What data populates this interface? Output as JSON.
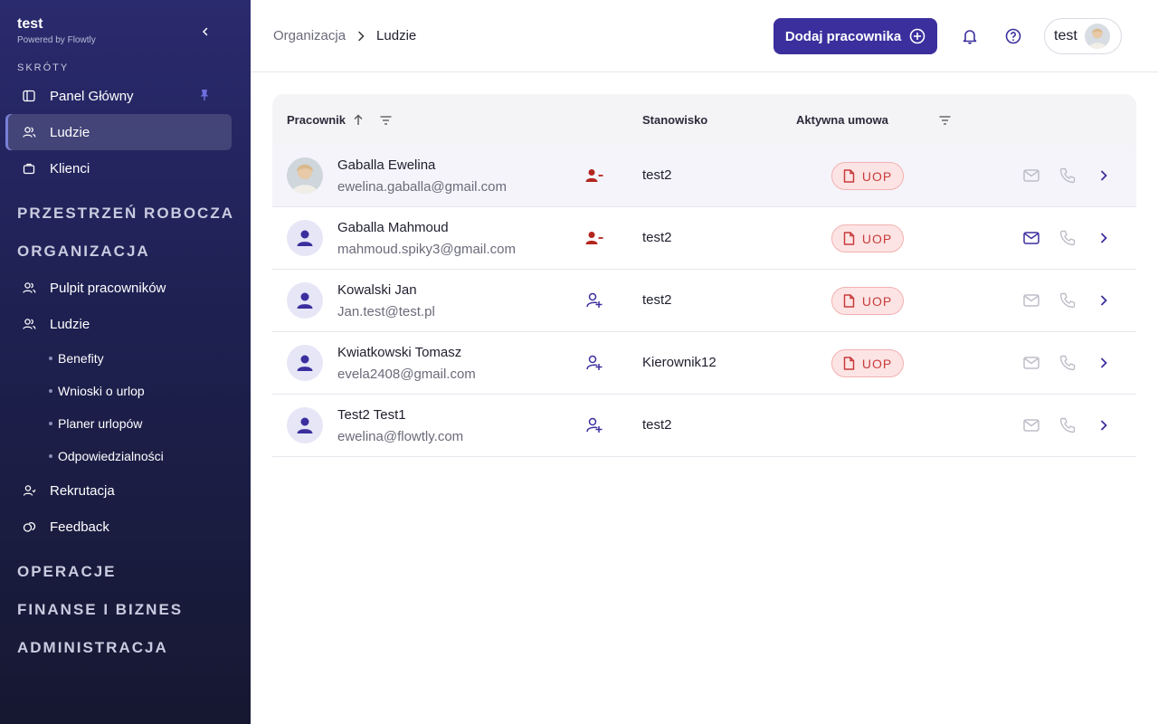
{
  "colors": {
    "sidebar_bg": "#1e2050",
    "primary": "#3b2f9e",
    "danger": "#c83b3b",
    "badge_bg": "#fde4e4"
  },
  "sidebar": {
    "brand_name": "test",
    "brand_sub": "Powered by Flowtly",
    "shortcuts_label": "SKRÓTY",
    "shortcuts": [
      {
        "label": "Panel Główny",
        "icon": "sidebar-panel-icon",
        "pinned": true
      },
      {
        "label": "Ludzie",
        "icon": "people-icon",
        "active": true
      },
      {
        "label": "Klienci",
        "icon": "briefcase-icon"
      }
    ],
    "sections": {
      "workspace": "PRZESTRZEŃ ROBOCZA",
      "organization": "ORGANIZACJA",
      "operations": "OPERACJE",
      "finance": "FINANSE I BIZNES",
      "admin": "ADMINISTRACJA"
    },
    "org_items": [
      {
        "label": "Pulpit pracowników",
        "icon": "people-icon"
      },
      {
        "label": "Ludzie",
        "icon": "people-icon"
      }
    ],
    "sub_items": [
      "Benefity",
      "Wnioski o urlop",
      "Planer urlopów",
      "Odpowiedzialności"
    ],
    "more_items": [
      {
        "label": "Rekrutacja",
        "icon": "recruit-icon"
      },
      {
        "label": "Feedback",
        "icon": "feedback-icon"
      }
    ]
  },
  "header": {
    "breadcrumb": [
      "Organizacja",
      "Ludzie"
    ],
    "add_button": "Dodaj pracownika",
    "user_name": "test"
  },
  "table": {
    "columns": {
      "employee": "Pracownik",
      "position": "Stanowisko",
      "contract": "Aktywna umowa"
    },
    "rows": [
      {
        "name": "Gaballa Ewelina",
        "email": "ewelina.gaballa@gmail.com",
        "status": "user-remove-icon",
        "position": "test2",
        "contract": "UOP",
        "email_active": false,
        "photo": true
      },
      {
        "name": "Gaballa Mahmoud",
        "email": "mahmoud.spiky3@gmail.com",
        "status": "user-remove-icon",
        "position": "test2",
        "contract": "UOP",
        "email_active": true,
        "photo": false
      },
      {
        "name": "Kowalski Jan",
        "email": "Jan.test@test.pl",
        "status": "user-add-icon",
        "position": "test2",
        "contract": "UOP",
        "email_active": false,
        "photo": false
      },
      {
        "name": "Kwiatkowski Tomasz",
        "email": "evela2408@gmail.com",
        "status": "user-add-icon",
        "position": "Kierownik12",
        "contract": "UOP",
        "email_active": false,
        "photo": false
      },
      {
        "name": "Test2 Test1",
        "email": "ewelina@flowtly.com",
        "status": "user-add-icon",
        "position": "test2",
        "contract": "",
        "email_active": false,
        "photo": false
      }
    ]
  }
}
